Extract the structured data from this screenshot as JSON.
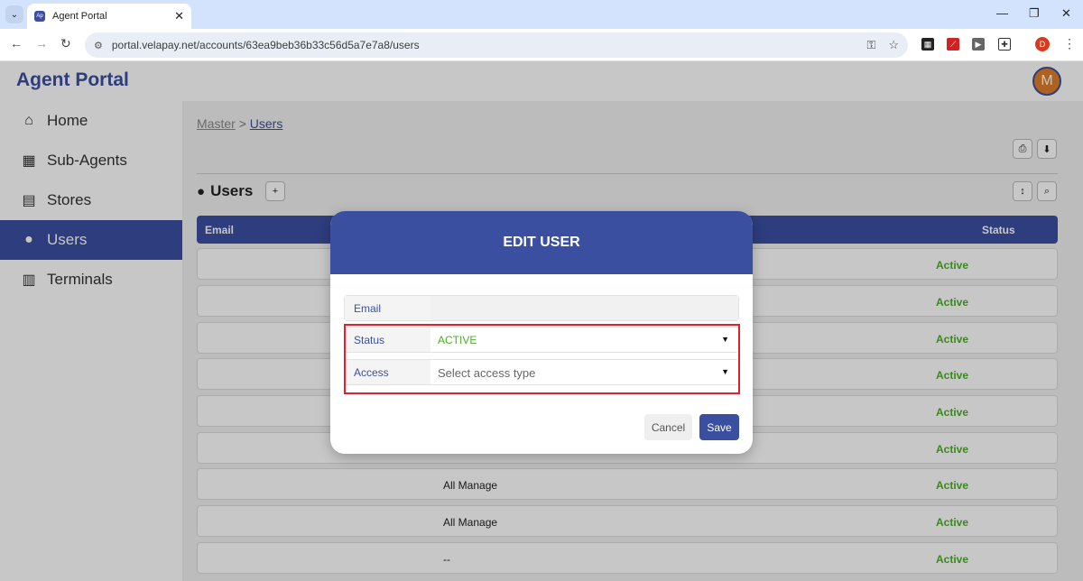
{
  "browser": {
    "tab_title": "Agent Portal",
    "favicon_label": "Ap",
    "url": "portal.velapay.net/accounts/63ea9beb36b33c56d5a7e7a8/users",
    "profile_initial": "D"
  },
  "app": {
    "title": "Agent Portal",
    "avatar_initial": "M"
  },
  "sidebar": {
    "items": [
      {
        "label": "Home",
        "icon": "home-icon",
        "active": false
      },
      {
        "label": "Sub-Agents",
        "icon": "building-icon",
        "active": false
      },
      {
        "label": "Stores",
        "icon": "store-icon",
        "active": false
      },
      {
        "label": "Users",
        "icon": "user-icon",
        "active": true
      },
      {
        "label": "Terminals",
        "icon": "cash-register-icon",
        "active": false
      }
    ]
  },
  "breadcrumb": {
    "root": "Master",
    "separator": ">",
    "current": "Users"
  },
  "section": {
    "title": "Users"
  },
  "table": {
    "headers": {
      "email": "Email",
      "status": "Status"
    },
    "rows": [
      {
        "access": "",
        "status": "Active"
      },
      {
        "access": "",
        "status": "Active"
      },
      {
        "access": "",
        "status": "Active"
      },
      {
        "access": "",
        "status": "Active"
      },
      {
        "access": "",
        "status": "Active"
      },
      {
        "access": "",
        "status": "Active"
      },
      {
        "access": "All Manage",
        "status": "Active"
      },
      {
        "access": "All Manage",
        "status": "Active"
      },
      {
        "access": "--",
        "status": "Active"
      }
    ]
  },
  "modal": {
    "title": "EDIT USER",
    "fields": {
      "email_label": "Email",
      "email_value": "",
      "status_label": "Status",
      "status_value": "ACTIVE",
      "access_label": "Access",
      "access_placeholder": "Select access type"
    },
    "cancel_label": "Cancel",
    "save_label": "Save"
  },
  "colors": {
    "brand": "#3b4fa0",
    "active_status": "#4caf26",
    "highlight": "#e0202a",
    "avatar": "#e07e2a"
  }
}
